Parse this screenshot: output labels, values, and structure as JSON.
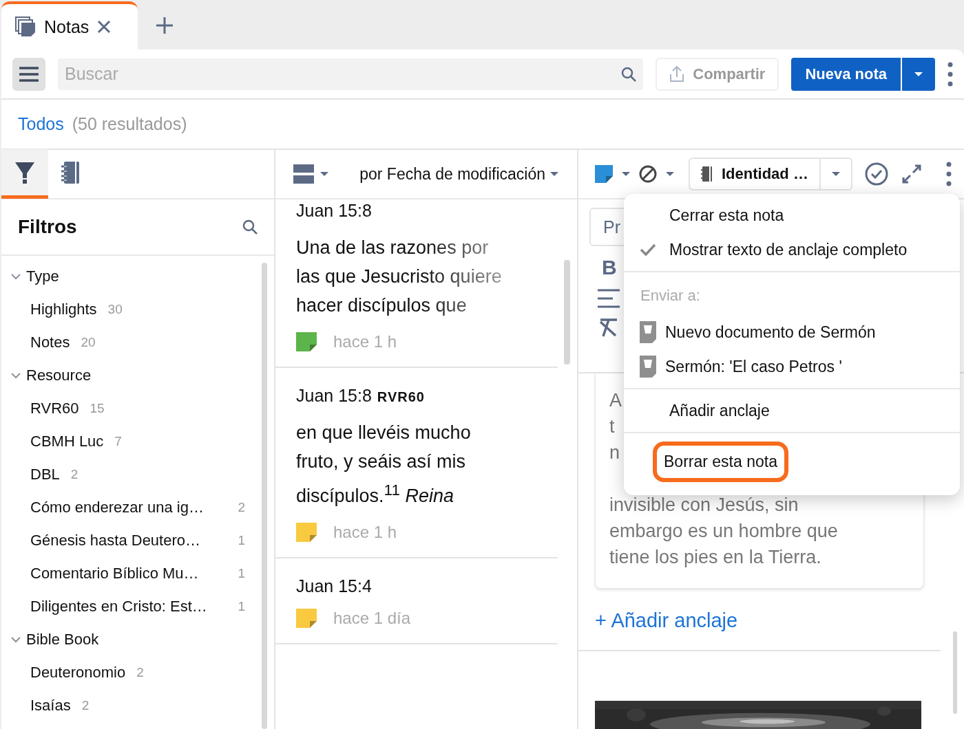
{
  "tabs": [
    {
      "label": "Notas",
      "selected": true
    }
  ],
  "toolbar": {
    "search": {
      "placeholder": "Buscar"
    },
    "share_button": {
      "label": "Compartir",
      "disabled": true
    },
    "new_button": "Nueva nota"
  },
  "results": {
    "filter": "Todos",
    "count": "(50 resultados)"
  },
  "sidebar": {
    "tabs": [
      {
        "kind": "filter",
        "selected": true
      },
      {
        "kind": "notebook",
        "selected": false
      }
    ],
    "title": "Filtros",
    "tree": [
      {
        "label": "Type",
        "expanded": true,
        "children": [
          {
            "label": "Highlights",
            "count": "30"
          },
          {
            "label": "Notes",
            "count": "20"
          }
        ]
      },
      {
        "label": "Resource",
        "expanded": true,
        "children": [
          {
            "label": "RVR60",
            "count": "15"
          },
          {
            "label": "CBMH Luc",
            "count": "7"
          },
          {
            "label": "DBL",
            "count": "2"
          },
          {
            "label": "Cómo enderezar una ig…",
            "count": "2"
          },
          {
            "label": "Génesis hasta Deutero…",
            "count": "1"
          },
          {
            "label": "Comentario Bíblico Mu…",
            "count": "1"
          },
          {
            "label": "Diligentes en Cristo: Est…",
            "count": "1"
          }
        ]
      },
      {
        "label": "Bible Book",
        "expanded": true,
        "children": [
          {
            "label": "Deuteronomio",
            "count": "2"
          },
          {
            "label": "Isaías",
            "count": "2"
          }
        ]
      }
    ]
  },
  "note_list": {
    "sort": "por Fecha de modificación",
    "notes": [
      {
        "reference": "Juan 15:8",
        "text": "Una de las razones por las que Jesucristo quiere hacer discípulos que",
        "faded": true,
        "color": "#5cb54a",
        "time": "hace 1 h"
      },
      {
        "reference": "Juan 15:8",
        "version": "RVR60",
        "text": "en que llevéis mucho fruto, y seáis así mis discípulos.$^{11}$ *Reina*",
        "faded": false,
        "color": "#f9c940",
        "time": "hace 1 h"
      },
      {
        "reference": "Juan 15:4",
        "color": "#f9c940",
        "time": "hace 1 día"
      }
    ]
  },
  "editor": {
    "color_button": {
      "color": "#2a8fd6"
    },
    "notebook": "Identidad …",
    "field_value": "Pr",
    "bold_label": "B",
    "card_lines": [
      "A",
      "t",
      "n",
      "invisible con Jesús, sin",
      "embargo es un hombre que",
      "tiene los pies en la Tierra."
    ],
    "add_anchor": "+ Añadir anclaje",
    "picture": {
      "kind": "picture"
    }
  },
  "menu": {
    "items": [
      {
        "kind": "item",
        "label": "Cerrar esta nota",
        "checked": false,
        "highlighted": false
      },
      {
        "kind": "item",
        "label": "Mostrar texto de anclaje completo",
        "checked": true,
        "highlighted": false
      },
      {
        "kind": "divider"
      },
      {
        "kind": "header",
        "label": "Enviar a:"
      },
      {
        "kind": "doc",
        "label": "Nuevo documento de Sermón"
      },
      {
        "kind": "doc",
        "label": "Sermón: 'El caso Petros '"
      },
      {
        "kind": "divider"
      },
      {
        "kind": "item",
        "label": "Añadir anclaje",
        "checked": false,
        "highlighted": false
      },
      {
        "kind": "divider"
      },
      {
        "kind": "item",
        "label": "Borrar esta nota",
        "checked": false,
        "highlighted": true
      }
    ]
  }
}
